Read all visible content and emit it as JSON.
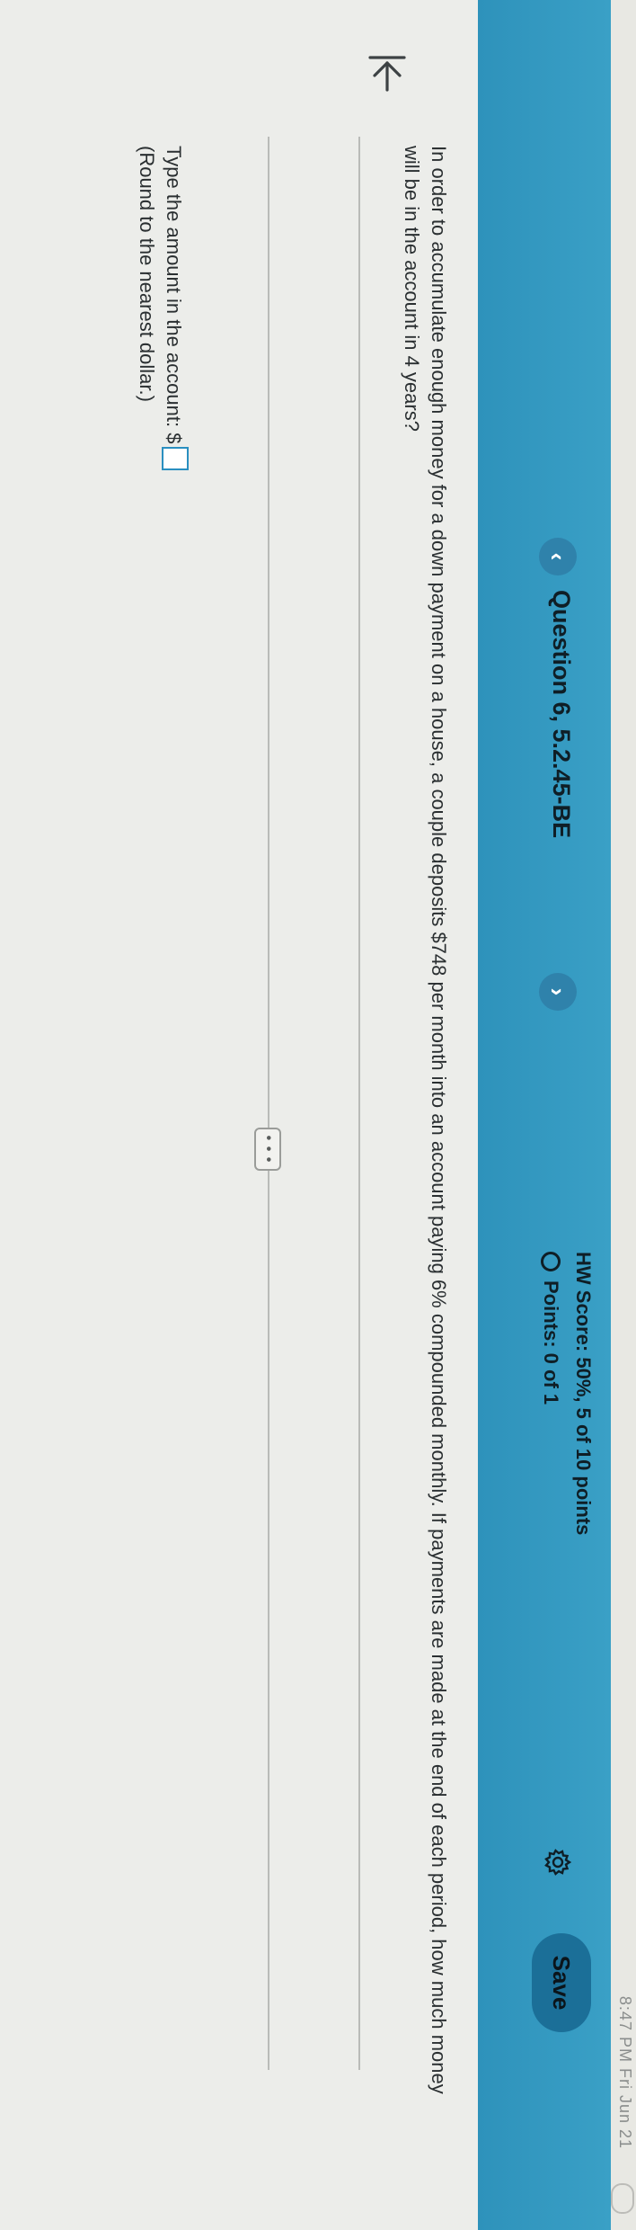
{
  "status_bar": {
    "time": "8:47 PM Fri Jun 21"
  },
  "header": {
    "question_title": "Question 6, 5.2.45-BE",
    "prev_glyph": "‹",
    "next_glyph": "›",
    "hw_score": "HW Score: 50%, 5 of 10 points",
    "points": "Points: 0 of 1",
    "save_label": "Save"
  },
  "question": {
    "text": "In order to accumulate enough money for a down payment on a house, a couple deposits $748 per month into an account paying 6% compounded monthly. If payments are made at the end of each period, how much money will be in the account in 4 years?"
  },
  "more_label": "• • •",
  "answer": {
    "label": "Type the amount in the account: $",
    "value": "",
    "hint": "(Round to the nearest dollar.)"
  },
  "colors": {
    "header": "#3aa0c6",
    "nav_button": "#2f82ab",
    "save_button": "#1b6f98",
    "input_border": "#2a8fc0",
    "page_background": "#ecedea"
  }
}
